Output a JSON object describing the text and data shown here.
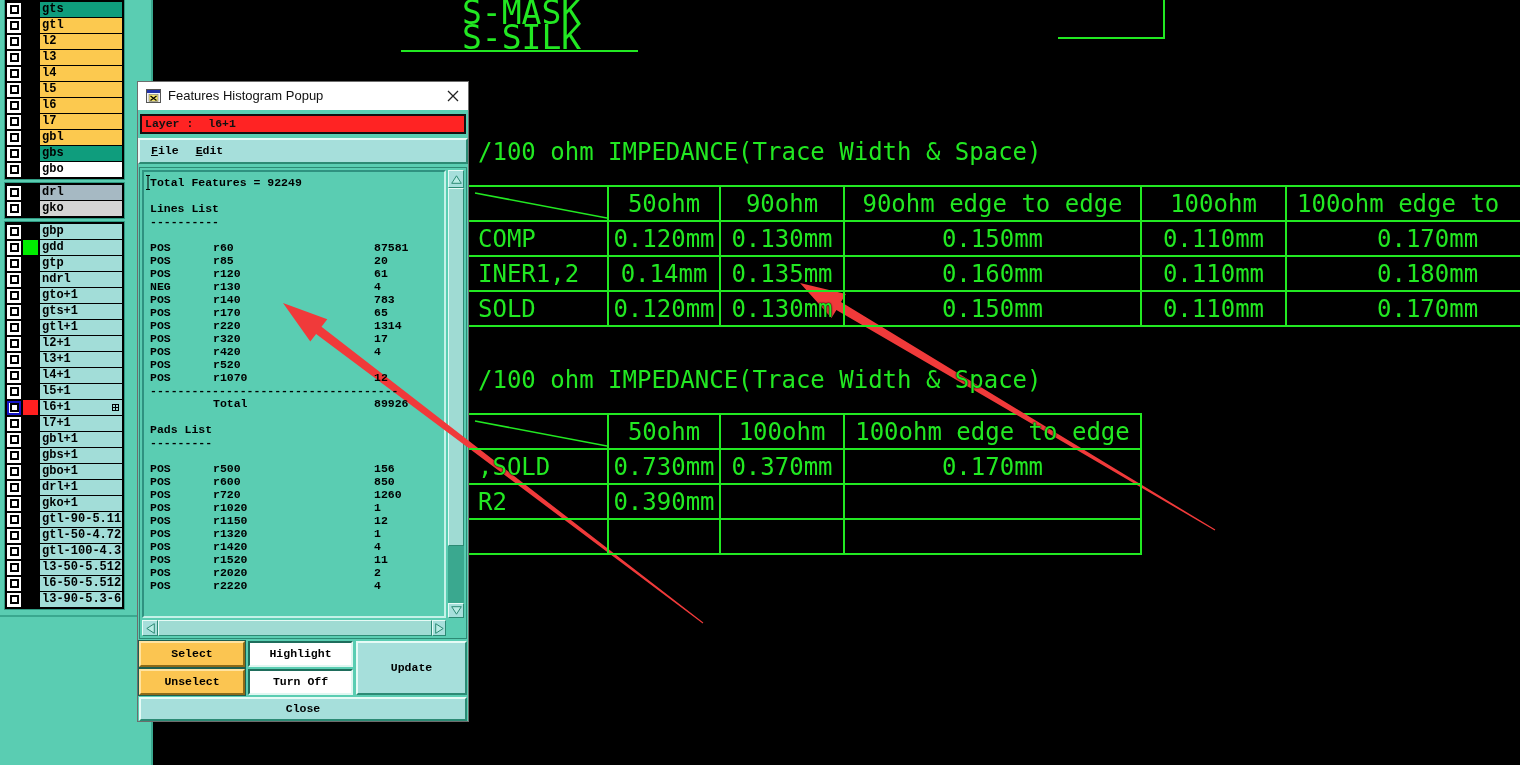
{
  "layer_panel": {
    "groups": [
      {
        "layers": [
          {
            "name": "gts",
            "kind": "mask",
            "selected": false
          },
          {
            "name": "gtl",
            "kind": "signal",
            "selected": false
          },
          {
            "name": "l2",
            "kind": "signal",
            "selected": false
          },
          {
            "name": "l3",
            "kind": "signal",
            "selected": false
          },
          {
            "name": "l4",
            "kind": "signal",
            "selected": false
          },
          {
            "name": "l5",
            "kind": "signal",
            "selected": false
          },
          {
            "name": "l6",
            "kind": "signal",
            "selected": false
          },
          {
            "name": "l7",
            "kind": "signal",
            "selected": false
          },
          {
            "name": "gbl",
            "kind": "signal",
            "selected": false
          },
          {
            "name": "gbs",
            "kind": "mask",
            "selected": false
          },
          {
            "name": "gbo",
            "kind": "silk",
            "selected": false
          }
        ]
      },
      {
        "layers": [
          {
            "name": "drl",
            "kind": "drill",
            "selected": false
          },
          {
            "name": "gko",
            "kind": "rout",
            "selected": false
          }
        ]
      },
      {
        "layers": [
          {
            "name": "gbp",
            "kind": "misc",
            "selected": false
          },
          {
            "name": "gdd",
            "kind": "misc",
            "selected": false,
            "color": "#00ee00"
          },
          {
            "name": "gtp",
            "kind": "misc",
            "selected": false
          },
          {
            "name": "ndrl",
            "kind": "misc",
            "selected": false
          },
          {
            "name": "gto+1",
            "kind": "misc",
            "selected": false
          },
          {
            "name": "gts+1",
            "kind": "misc",
            "selected": false
          },
          {
            "name": "gtl+1",
            "kind": "misc",
            "selected": false
          },
          {
            "name": "l2+1",
            "kind": "misc",
            "selected": false
          },
          {
            "name": "l3+1",
            "kind": "misc",
            "selected": false
          },
          {
            "name": "l4+1",
            "kind": "misc",
            "selected": false
          },
          {
            "name": "l5+1",
            "kind": "misc",
            "selected": false
          },
          {
            "name": "l6+1",
            "kind": "misc",
            "selected": true,
            "color": "#ff2020"
          },
          {
            "name": "l7+1",
            "kind": "misc",
            "selected": false
          },
          {
            "name": "gbl+1",
            "kind": "misc",
            "selected": false
          },
          {
            "name": "gbs+1",
            "kind": "misc",
            "selected": false
          },
          {
            "name": "gbo+1",
            "kind": "misc",
            "selected": false
          },
          {
            "name": "drl+1",
            "kind": "misc",
            "selected": false
          },
          {
            "name": "gko+1",
            "kind": "misc",
            "selected": false
          },
          {
            "name": "gtl-90-5.11",
            "kind": "misc",
            "selected": false
          },
          {
            "name": "gtl-50-4.72",
            "kind": "misc",
            "selected": false
          },
          {
            "name": "gtl-100-4.3",
            "kind": "misc",
            "selected": false
          },
          {
            "name": "l3-50-5.512",
            "kind": "misc",
            "selected": false
          },
          {
            "name": "l6-50-5.512",
            "kind": "misc",
            "selected": false
          },
          {
            "name": "l3-90-5.3-6",
            "kind": "misc",
            "selected": false
          }
        ]
      }
    ]
  },
  "popup": {
    "title": "Features Histogram Popup",
    "layer_label": "Layer :",
    "layer": "l6+1",
    "menu": [
      "File",
      "Edit"
    ],
    "report": {
      "total_line": "Total Features = 92249",
      "sections": [
        {
          "title": "Lines List",
          "rule": "----------",
          "rows": [
            {
              "polarity": "POS",
              "symbol": "r60",
              "count": "87581"
            },
            {
              "polarity": "POS",
              "symbol": "r85",
              "count": "20"
            },
            {
              "polarity": "POS",
              "symbol": "r120",
              "count": "61"
            },
            {
              "polarity": "NEG",
              "symbol": "r130",
              "count": "4"
            },
            {
              "polarity": "POS",
              "symbol": "r140",
              "count": "783"
            },
            {
              "polarity": "POS",
              "symbol": "r170",
              "count": "65"
            },
            {
              "polarity": "POS",
              "symbol": "r220",
              "count": "1314"
            },
            {
              "polarity": "POS",
              "symbol": "r320",
              "count": "17"
            },
            {
              "polarity": "POS",
              "symbol": "r420",
              "count": "4"
            },
            {
              "polarity": "POS",
              "symbol": "r520"
            },
            {
              "polarity": "POS",
              "symbol": "r1070",
              "count": "12"
            }
          ],
          "separator": "------------------------------------",
          "total_label": "Total",
          "total": "89926"
        },
        {
          "title": "Pads List",
          "rule": "---------",
          "rows": [
            {
              "polarity": "POS",
              "symbol": "r500",
              "count": "156"
            },
            {
              "polarity": "POS",
              "symbol": "r600",
              "count": "850"
            },
            {
              "polarity": "POS",
              "symbol": "r720",
              "count": "1260"
            },
            {
              "polarity": "POS",
              "symbol": "r1020",
              "count": "1"
            },
            {
              "polarity": "POS",
              "symbol": "r1150",
              "count": "12"
            },
            {
              "polarity": "POS",
              "symbol": "r1320",
              "count": "1"
            },
            {
              "polarity": "POS",
              "symbol": "r1420",
              "count": "4"
            },
            {
              "polarity": "POS",
              "symbol": "r1520",
              "count": "11"
            },
            {
              "polarity": "POS",
              "symbol": "r2020",
              "count": "2"
            },
            {
              "polarity": "POS",
              "symbol": "r2220",
              "count": "4"
            }
          ]
        }
      ]
    },
    "buttons": [
      {
        "label": "Select",
        "kind": "action"
      },
      {
        "label": "Unselect",
        "kind": "action"
      },
      {
        "label": "Highlight",
        "kind": "toggle"
      },
      {
        "label": "Turn Off",
        "kind": "toggle"
      },
      {
        "label": "Update",
        "kind": "command"
      },
      {
        "label": "Close",
        "kind": "close"
      }
    ]
  },
  "cad_view": {
    "labels": [
      "S-MASK",
      "S-SILK"
    ],
    "sections": [
      {
        "heading": "/100 ohm IMPEDANCE(Trace Width & Space)",
        "columns": [
          "50ohm",
          "90ohm",
          "90ohm edge to edge",
          "100ohm",
          "100ohm edge to"
        ],
        "rows": [
          {
            "label": "COMP",
            "cells": [
              "0.120mm",
              "0.130mm",
              "0.150mm",
              "0.110mm",
              "0.170mm"
            ]
          },
          {
            "label": "INER1,2",
            "cells": [
              "0.14mm",
              "0.135mm",
              "0.160mm",
              "0.110mm",
              "0.180mm"
            ]
          },
          {
            "label": "SOLD",
            "cells": [
              "0.120mm",
              "0.130mm",
              "0.150mm",
              "0.110mm",
              "0.170mm"
            ]
          }
        ]
      },
      {
        "heading": "/100 ohm IMPEDANCE(Trace Width & Space)",
        "columns": [
          "50ohm",
          "100ohm",
          "100ohm edge to edge"
        ],
        "rows": [
          {
            "label": ",SOLD",
            "cells": [
              "0.730mm",
              "0.370mm",
              "0.170mm"
            ]
          },
          {
            "label": "R2",
            "cells": [
              "0.390mm"
            ]
          },
          {}
        ]
      }
    ]
  }
}
